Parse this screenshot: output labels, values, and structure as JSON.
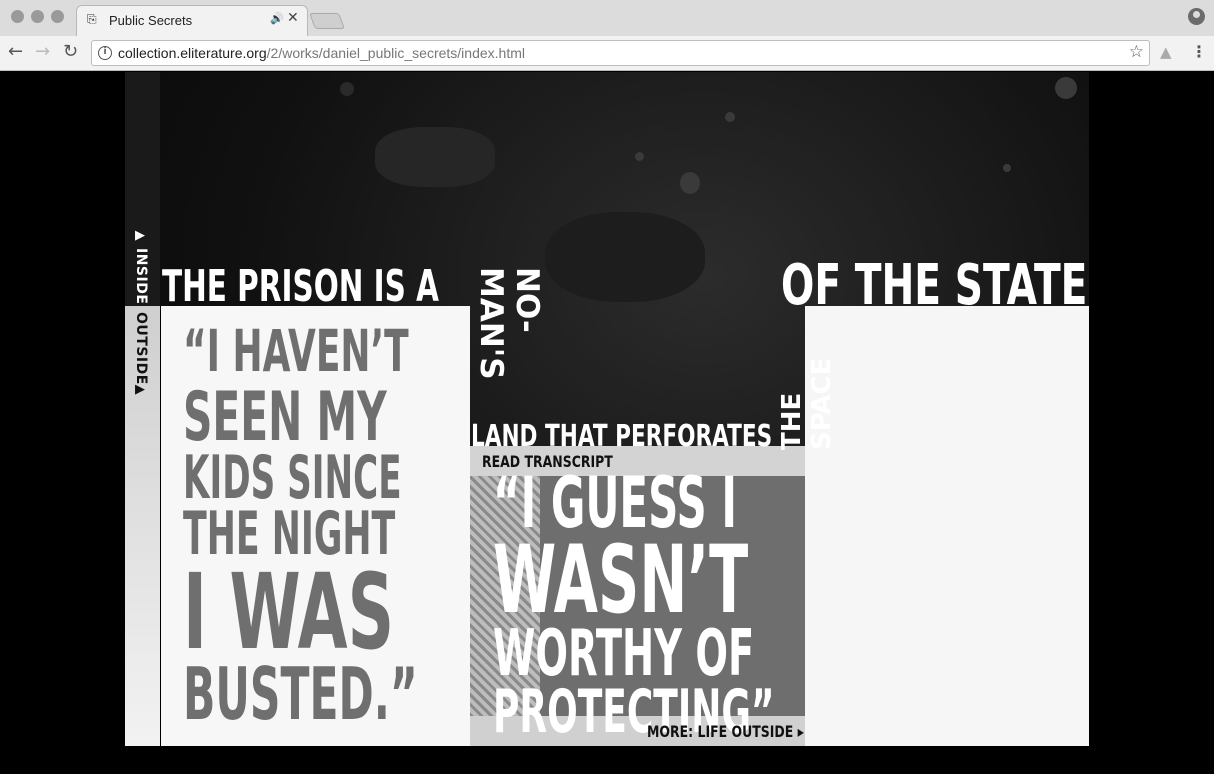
{
  "browser": {
    "tab": {
      "title": "Public Secrets"
    },
    "address": {
      "host": "collection.eliterature.org",
      "path": "/2/works/daniel_public_secrets/index.html"
    }
  },
  "sidebar": {
    "inside_label": "INSIDE",
    "outside_label": "OUTSIDE"
  },
  "headline": {
    "part1": "THE PRISON IS A",
    "part2": "NO-MAN'S",
    "part3": "LAND THAT PERFORATES",
    "part4": "THE SPACE",
    "part5": "OF THE STATE"
  },
  "quote_left": {
    "line1": "“I HAVEN’T",
    "line2": "SEEN MY",
    "line3": "KIDS SINCE",
    "line4": "THE NIGHT",
    "line5": "I WAS",
    "line6": "BUSTED.”"
  },
  "quote_mid": {
    "line1": "“I GUESS I",
    "line2": "WASN’T",
    "line3": "WORTHY OF",
    "line4": "PROTECTING”"
  },
  "read_transcript_label": "READ TRANSCRIPT",
  "more_link_label": "MORE: LIFE OUTSIDE"
}
